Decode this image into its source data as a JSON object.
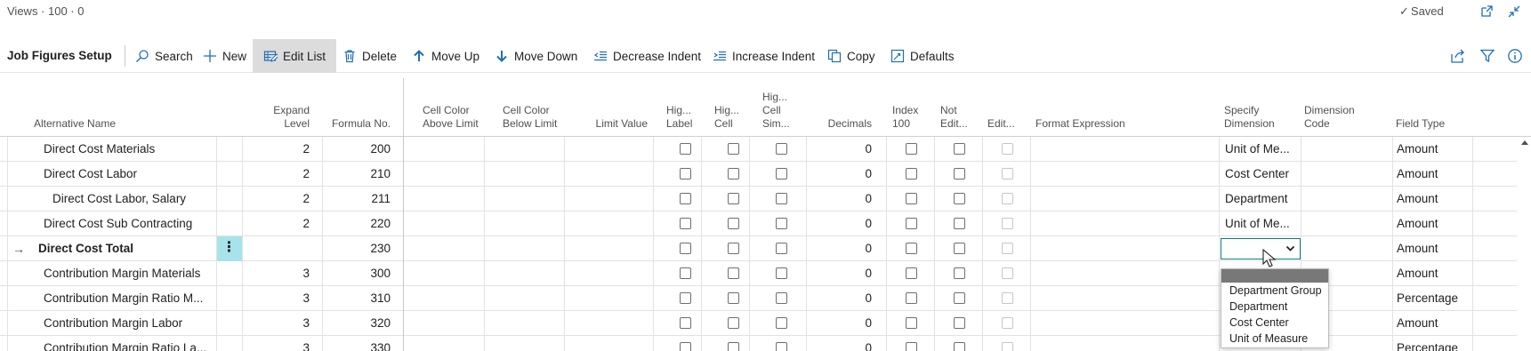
{
  "topbar": {
    "breadcrumb": "Views · 100 · 0",
    "saved_status": "Saved"
  },
  "actions": {
    "page_title": "Job Figures Setup",
    "search": "Search",
    "new": "New",
    "edit_list": "Edit List",
    "delete": "Delete",
    "move_up": "Move Up",
    "move_down": "Move Down",
    "decrease_indent": "Decrease Indent",
    "increase_indent": "Increase Indent",
    "copy": "Copy",
    "defaults": "Defaults"
  },
  "columns": {
    "alternative_name": "Alternative Name",
    "expand_level_1": "Expand",
    "expand_level_2": "Level",
    "formula_no": "Formula No.",
    "cell_color_above_1": "Cell Color",
    "cell_color_above_2": "Above Limit",
    "cell_color_below_1": "Cell Color",
    "cell_color_below_2": "Below Limit",
    "limit_value": "Limit Value",
    "hig_label_1": "Hig...",
    "hig_label_2": "Label",
    "hig_cell_1": "Hig...",
    "hig_cell_2": "Cell",
    "hig_cell_sim_1": "Hig...",
    "hig_cell_sim_2": "Cell",
    "hig_cell_sim_3": "Sim...",
    "decimals": "Decimals",
    "index100_1": "Index",
    "index100_2": "100",
    "not_edit_1": "Not",
    "not_edit_2": "Edit...",
    "edit": "Edit...",
    "format_expression": "Format Expression",
    "specify_dimension_1": "Specify",
    "specify_dimension_2": "Dimension",
    "dimension_code_1": "Dimension",
    "dimension_code_2": "Code",
    "field_type": "Field Type"
  },
  "rows": [
    {
      "name": "Direct Cost Materials",
      "expand_level": "2",
      "formula_no": "200",
      "decimals": "0",
      "specify_dimension": "Unit of Me...",
      "field_type": "Amount"
    },
    {
      "name": "Direct Cost Labor",
      "expand_level": "2",
      "formula_no": "210",
      "decimals": "0",
      "specify_dimension": "Cost Center",
      "field_type": "Amount"
    },
    {
      "name": "Direct Cost Labor, Salary",
      "expand_level": "2",
      "formula_no": "211",
      "decimals": "0",
      "specify_dimension": "Department",
      "field_type": "Amount"
    },
    {
      "name": "Direct Cost Sub Contracting",
      "expand_level": "2",
      "formula_no": "220",
      "decimals": "0",
      "specify_dimension": "Unit of Me...",
      "field_type": "Amount"
    },
    {
      "name": "Direct Cost Total",
      "expand_level": "",
      "formula_no": "230",
      "decimals": "0",
      "specify_dimension": "",
      "field_type": "Amount"
    },
    {
      "name": "Contribution Margin Materials",
      "expand_level": "3",
      "formula_no": "300",
      "decimals": "0",
      "specify_dimension": "",
      "field_type": "Amount"
    },
    {
      "name": "Contribution Margin Ratio M...",
      "expand_level": "3",
      "formula_no": "310",
      "decimals": "0",
      "specify_dimension": "",
      "field_type": "Percentage"
    },
    {
      "name": "Contribution Margin Labor",
      "expand_level": "3",
      "formula_no": "320",
      "decimals": "0",
      "specify_dimension": "",
      "field_type": "Amount"
    },
    {
      "name": "Contribution Margin Ratio La...",
      "expand_level": "3",
      "formula_no": "330",
      "decimals": "0",
      "specify_dimension": "",
      "field_type": "Percentage"
    }
  ],
  "dropdown": {
    "options": [
      "Department Group",
      "Department",
      "Cost Center",
      "Unit of Measure"
    ]
  }
}
